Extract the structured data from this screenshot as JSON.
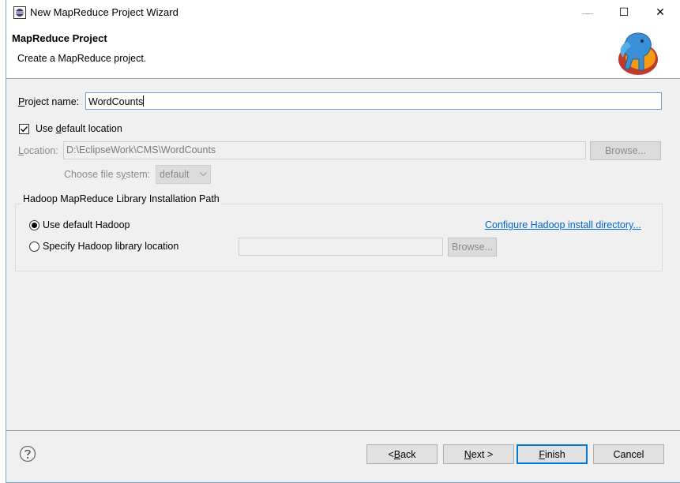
{
  "window": {
    "title": "New MapReduce Project Wizard",
    "minimize_symbol": "—",
    "maximize_symbol": "☐",
    "close_symbol": "✕"
  },
  "header": {
    "title": "MapReduce Project",
    "description": "Create a MapReduce project.",
    "logo_icon": "elephant-logo-icon"
  },
  "project": {
    "name_label_prefix": "P",
    "name_label_rest": "roject name:",
    "name_value": "WordCounts"
  },
  "location": {
    "use_default_prefix": "Use ",
    "use_default_mnemonic": "d",
    "use_default_rest": "efault location",
    "use_default_checked": true,
    "label_mnemonic": "L",
    "label_rest": "ocation:",
    "path": "D:\\EclipseWork\\CMS\\WordCounts",
    "browse_label": "Browse...",
    "fs_label_prefix": "Choose file s",
    "fs_mnemonic": "y",
    "fs_label_rest": "stem:",
    "fs_value": "default"
  },
  "hadoop": {
    "group_title": "Hadoop MapReduce Library Installation Path",
    "use_default_label": "Use default Hadoop",
    "use_default_selected": true,
    "configure_link": "Configure Hadoop install directory...",
    "specify_label": "Specify Hadoop library location",
    "specify_value": "",
    "browse_label": "Browse..."
  },
  "footer": {
    "help_icon": "help-icon",
    "back_label_prefix": "< ",
    "back_mnemonic": "B",
    "back_rest": "ack",
    "next_mnemonic": "N",
    "next_rest": "ext >",
    "finish_mnemonic": "F",
    "finish_rest": "inish",
    "cancel_label": "Cancel"
  }
}
